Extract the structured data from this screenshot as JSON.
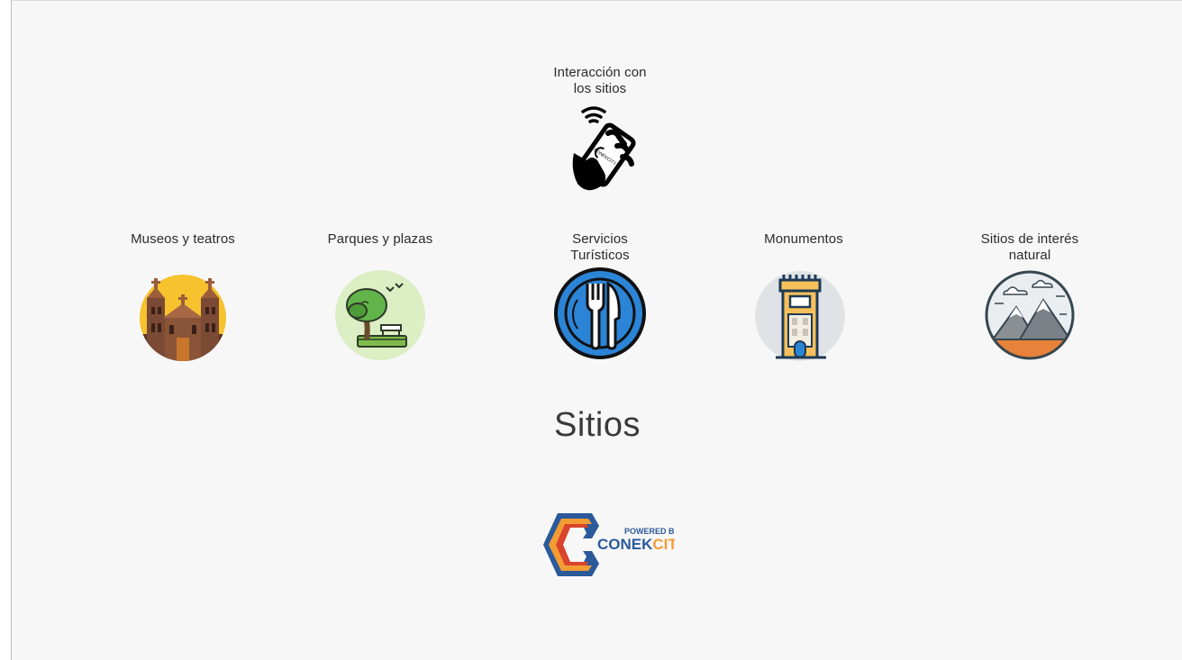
{
  "interaction": {
    "label": "Interacción con\nlos sitios",
    "icon": "phone-tap-icon",
    "icon_text": "CONEKCITY"
  },
  "categories": [
    {
      "label": "Museos y teatros",
      "icon": "cathedral-icon"
    },
    {
      "label": "Parques y plazas",
      "icon": "park-tree-icon"
    },
    {
      "label": "Servicios\nTurísticos",
      "icon": "fork-knife-plate-icon"
    },
    {
      "label": "Monumentos",
      "icon": "tower-icon"
    },
    {
      "label": "Sitios de interés\nnatural",
      "icon": "mountains-icon"
    }
  ],
  "page_title": "Sitios",
  "footer_logo": {
    "powered_by": "POWERED BY",
    "brand_part1": "CONEK",
    "brand_part2": "CITY",
    "colors": {
      "blue": "#2b5a9b",
      "orange": "#f39c34",
      "red": "#d9442b"
    }
  }
}
